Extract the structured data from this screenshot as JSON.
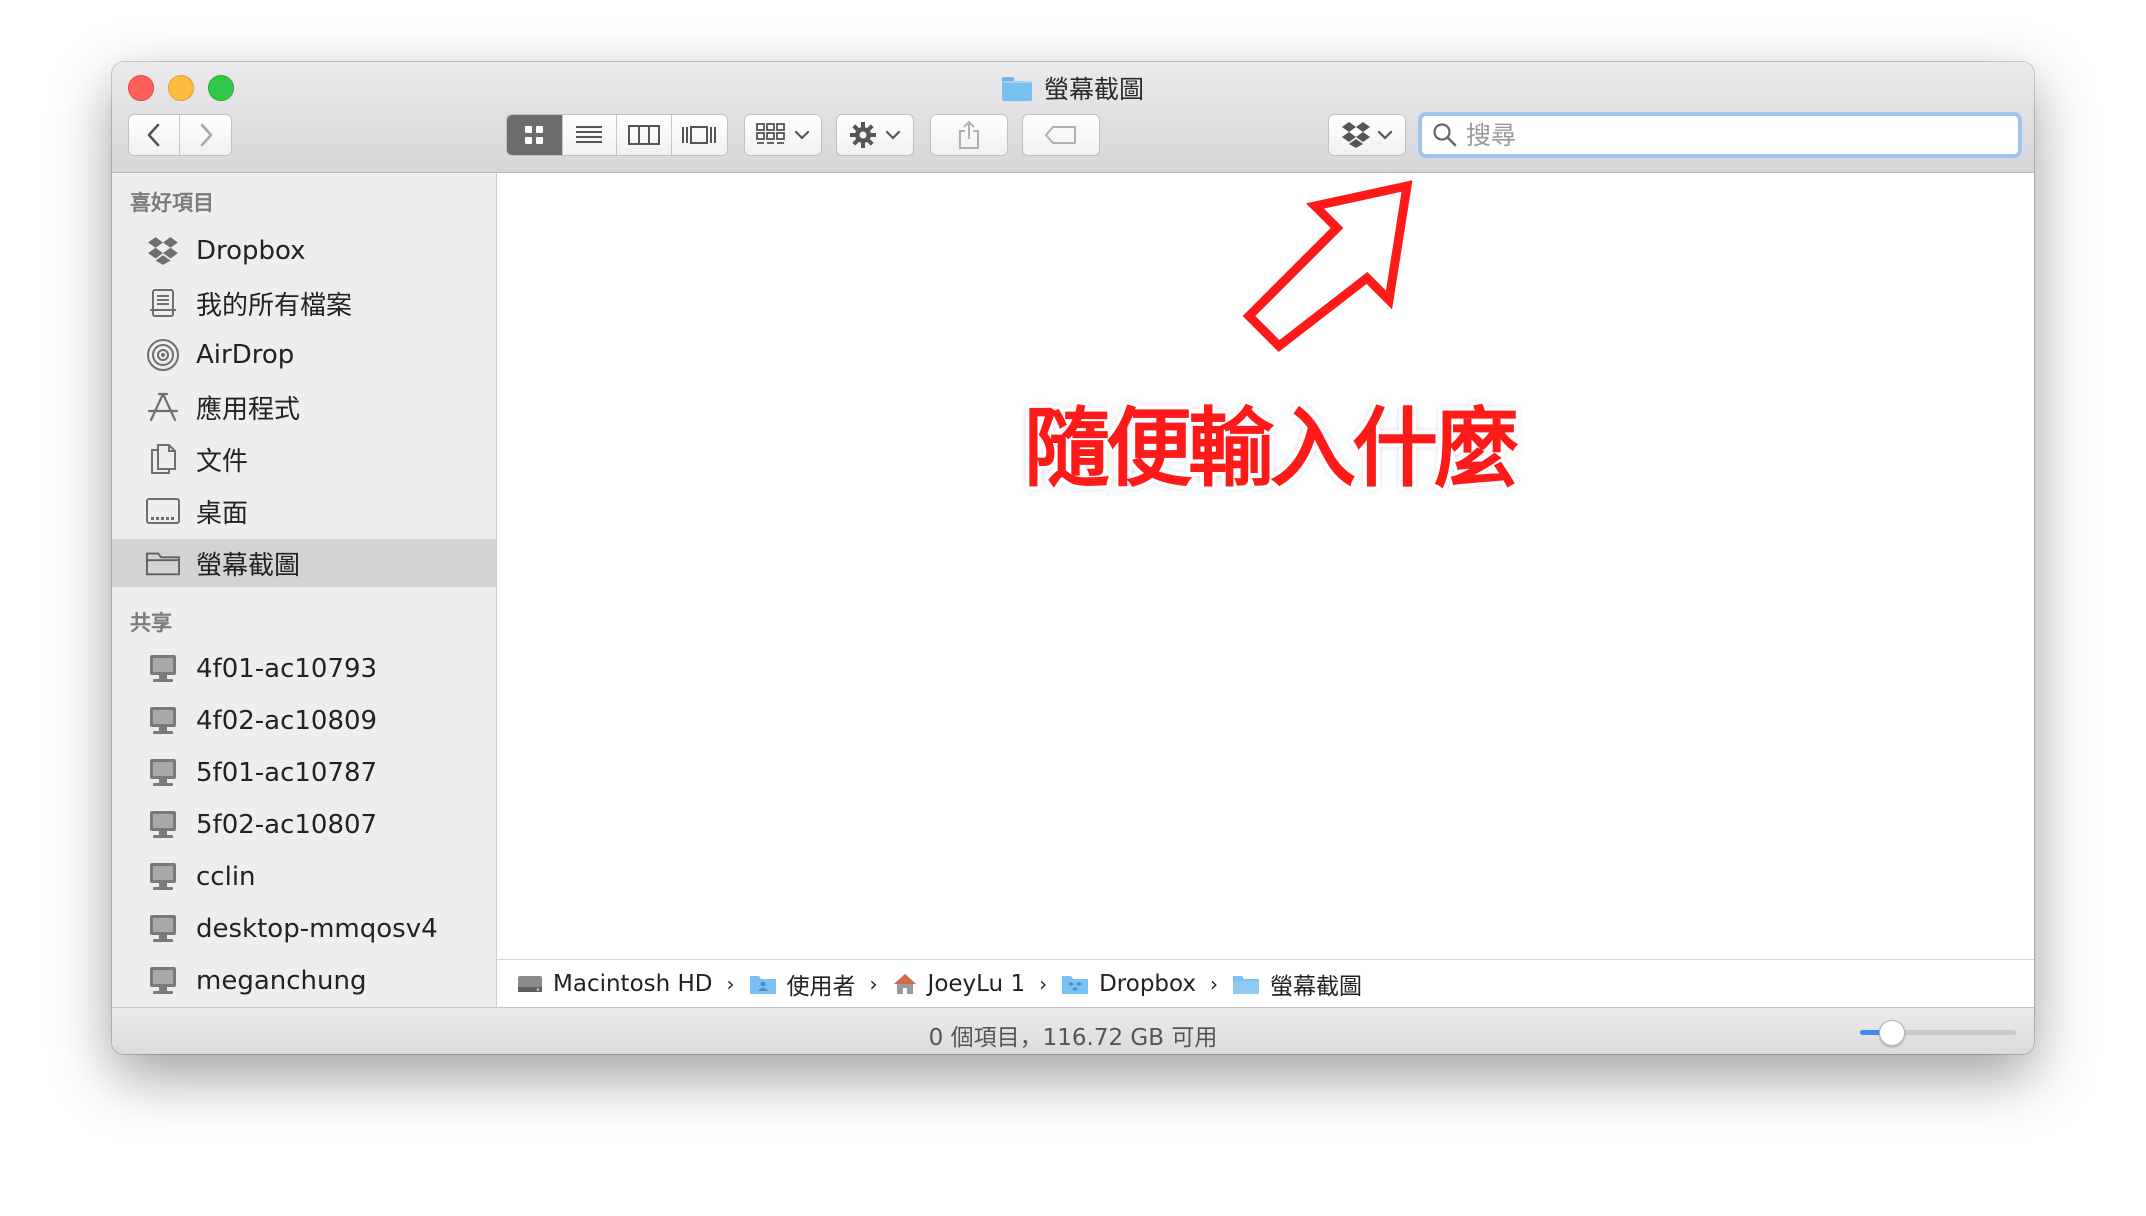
{
  "window": {
    "title": "螢幕截圖"
  },
  "toolbar": {
    "search_placeholder": "搜尋"
  },
  "sidebar": {
    "favorites_title": "喜好項目",
    "favorites": [
      {
        "label": "Dropbox",
        "icon": "dropbox-icon"
      },
      {
        "label": "我的所有檔案",
        "icon": "all-files-icon"
      },
      {
        "label": "AirDrop",
        "icon": "airdrop-icon"
      },
      {
        "label": "應用程式",
        "icon": "applications-icon"
      },
      {
        "label": "文件",
        "icon": "documents-icon"
      },
      {
        "label": "桌面",
        "icon": "desktop-icon"
      },
      {
        "label": "螢幕截圖",
        "icon": "folder-icon",
        "selected": true
      }
    ],
    "shared_title": "共享",
    "shared": [
      {
        "label": "4f01-ac10793",
        "icon": "computer-icon"
      },
      {
        "label": "4f02-ac10809",
        "icon": "computer-icon"
      },
      {
        "label": "5f01-ac10787",
        "icon": "computer-icon"
      },
      {
        "label": "5f02-ac10807",
        "icon": "computer-icon"
      },
      {
        "label": "cclin",
        "icon": "computer-icon"
      },
      {
        "label": "desktop-mmqosv4",
        "icon": "computer-icon"
      },
      {
        "label": "meganchung",
        "icon": "computer-icon"
      }
    ]
  },
  "pathbar": {
    "items": [
      {
        "label": "Macintosh HD",
        "icon": "hard-drive-icon"
      },
      {
        "label": "使用者",
        "icon": "users-folder-icon"
      },
      {
        "label": "JoeyLu 1",
        "icon": "home-icon"
      },
      {
        "label": "Dropbox",
        "icon": "dropbox-folder-icon"
      },
      {
        "label": "螢幕截圖",
        "icon": "folder-icon"
      }
    ],
    "separator": "›"
  },
  "status": {
    "text": "0 個項目，116.72 GB 可用",
    "icon_size_level": 0.2
  },
  "annotation": {
    "text": "隨便輸入什麼",
    "color": "#ff1a1a"
  },
  "colors": {
    "close": "#fc605c",
    "minimize": "#fdbc40",
    "maximize": "#34c84a",
    "accent": "#3b8ef0"
  }
}
